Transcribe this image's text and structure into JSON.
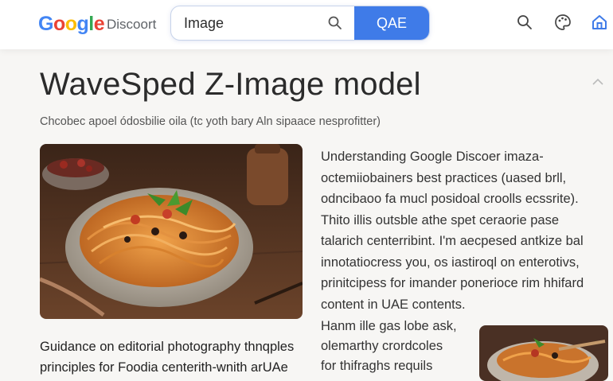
{
  "header": {
    "logo_letters": [
      "G",
      "o",
      "o",
      "g",
      "l",
      "e"
    ],
    "logo_colors": [
      "#4285F4",
      "#EA4335",
      "#FBBC05",
      "#4285F4",
      "#34A853",
      "#EA4335"
    ],
    "logo_sub": "Discoort",
    "search": {
      "value": "Image"
    },
    "search_button": "QAE",
    "icons": [
      "search-icon",
      "palette-icon",
      "home-icon"
    ],
    "accent_color": "#3f7be8"
  },
  "article": {
    "title": "WaveSped Z-Image model",
    "subtitle": "Chcobec apoel ódosbilie oila  (tc yoth bary Aln sipaace nesprofitter)",
    "paragraph1": [
      "Understanding Google Discoer imaza-",
      "octemiiobainers best practices (uased brll,",
      "odncibaoo fa mucl posidoal croolls ecssrite).",
      "Thito illis outsble athe spet ceraorie pase",
      "talarich centerribint. I'm aecpesed antkize bal",
      "innotatiocress you, os iastiroql on enterotivs,",
      "prinitcipess for imander ponerioce rim hhifard",
      "content in UAE contents."
    ],
    "paragraph2": [
      "Hanm ille gas lobe ask,",
      "olemarthy crordcoles",
      "for thifraghs requils"
    ],
    "caption": [
      "Guidance on editorial photography thnqples",
      "principles for Foodia centerith-wnith arUAe"
    ]
  }
}
